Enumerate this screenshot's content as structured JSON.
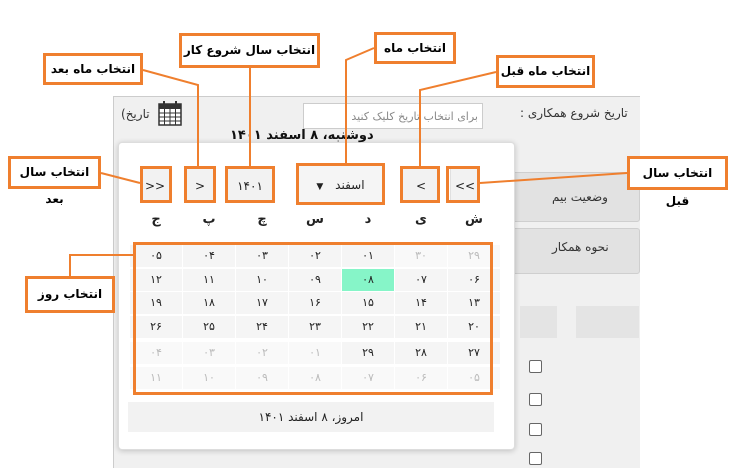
{
  "background": {
    "date_label": "تاریخ شروع همکاری :",
    "date_placeholder": "برای انتخاب تاریخ کلیک کنید",
    "date_link": "(تاریخ",
    "status_label": "وضعیت بیم",
    "cooperation_label": "نحوه همکار"
  },
  "datepicker": {
    "title": "دوشنبه، ۸ اسفند ۱۴۰۱",
    "prev_year": "<<",
    "prev_month": "<",
    "month": "اسفند",
    "year": "۱۴۰۱",
    "next_month": ">",
    "next_year": ">>",
    "weekdays": [
      "ش",
      "ی",
      "د",
      "س",
      "چ",
      "پ",
      "ج"
    ],
    "weeks": [
      [
        "۲۹",
        "۳۰",
        "۰۱",
        "۰۲",
        "۰۳",
        "۰۴",
        "۰۵"
      ],
      [
        "۰۶",
        "۰۷",
        "۰۸",
        "۰۹",
        "۱۰",
        "۱۱",
        "۱۲"
      ],
      [
        "۱۳",
        "۱۴",
        "۱۵",
        "۱۶",
        "۱۷",
        "۱۸",
        "۱۹"
      ],
      [
        "۲۰",
        "۲۱",
        "۲۲",
        "۲۳",
        "۲۴",
        "۲۵",
        "۲۶"
      ],
      [
        "۲۷",
        "۲۸",
        "۲۹",
        "۰۱",
        "۰۲",
        "۰۳",
        "۰۴"
      ],
      [
        "۰۵",
        "۰۶",
        "۰۷",
        "۰۸",
        "۰۹",
        "۱۰",
        "۱۱"
      ]
    ],
    "today": "امروز، ۸ اسفند ۱۴۰۱"
  },
  "annotations": {
    "next_month": "انتخاب ماه بعد",
    "start_year": "انتخاب سال شروع کار",
    "month": "انتخاب ماه",
    "prev_month": "انتخاب ماه قبل",
    "next_year": "انتخاب سال بعد",
    "prev_year": "انتخاب سال قبل",
    "day": "انتخاب روز"
  },
  "colors": {
    "accent": "#ef7f2e",
    "selected_day": "#86f5c8"
  }
}
